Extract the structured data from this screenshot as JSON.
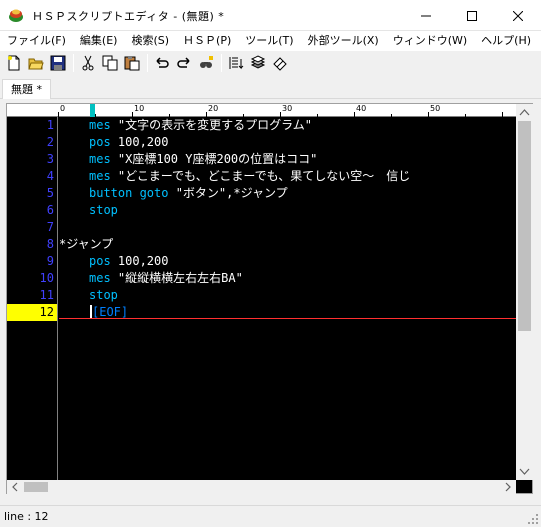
{
  "window": {
    "title": "ＨＳＰスクリプトエディタ - (無題) *"
  },
  "menu": [
    "ファイル(F)",
    "編集(E)",
    "検索(S)",
    "ＨＳＰ(P)",
    "ツール(T)",
    "外部ツール(X)",
    "ウィンドウ(W)",
    "ヘルプ(H)"
  ],
  "toolbar": {
    "icons": [
      "new-file-icon",
      "open-folder-icon",
      "save-icon",
      "cut-icon",
      "copy-icon",
      "paste-icon",
      "undo-icon",
      "redo-icon",
      "find-icon",
      "compile-run-icon",
      "stack-icon",
      "eraser-icon"
    ]
  },
  "tab": {
    "label": "無題 *"
  },
  "ruler": {
    "marks": [
      "0",
      "10",
      "20",
      "30",
      "40",
      "50"
    ]
  },
  "editor": {
    "line_numbers": [
      "1",
      "2",
      "3",
      "4",
      "5",
      "6",
      "7",
      "8",
      "9",
      "10",
      "11",
      "12"
    ],
    "current_line": 12,
    "lines": [
      {
        "kw": "mes",
        "rest": " \"文字の表示を変更するプログラム\""
      },
      {
        "kw": "pos",
        "rest": " 100,200"
      },
      {
        "kw": "mes",
        "rest": " \"X座標100 Y座標200の位置はココ\""
      },
      {
        "kw": "mes",
        "rest": " \"どこまーでも、どこまーでも、果てしない空～　信じ"
      },
      {
        "kw": "button goto",
        "rest": " \"ボタン\",*ジャンプ"
      },
      {
        "kw": "stop",
        "rest": ""
      },
      {
        "kw": "",
        "rest": ""
      },
      {
        "label": "*ジャンプ"
      },
      {
        "kw": "pos",
        "rest": " 100,200"
      },
      {
        "kw": "mes",
        "rest": " \"縦縦横横左右左右BA\""
      },
      {
        "kw": "stop",
        "rest": ""
      },
      {
        "eof": "[EOF]"
      }
    ]
  },
  "status": {
    "text": "line : 12"
  },
  "colors": {
    "keyword": "#00c0ff",
    "line_number": "#4040ff",
    "current_line_highlight": "#ffff00",
    "eof": "#0080ff"
  }
}
